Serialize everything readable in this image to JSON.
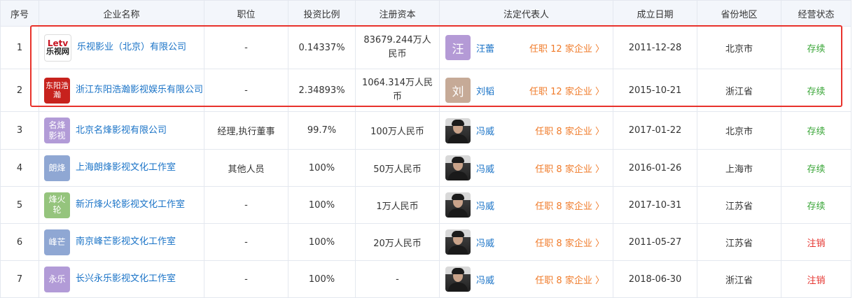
{
  "headers": [
    "序号",
    "企业名称",
    "职位",
    "投资比例",
    "注册资本",
    "法定代表人",
    "成立日期",
    "省份地区",
    "经营状态"
  ],
  "rows": [
    {
      "no": "1",
      "logo_text": "Letv乐视网",
      "company": "乐视影业（北京）有限公司",
      "position": "-",
      "ratio": "0.14337%",
      "capital": "83679.244万人民币",
      "rep_avatar": "汪",
      "rep": "汪蕾",
      "rep_link": "任职 12 家企业",
      "date": "2011-12-28",
      "region": "北京市",
      "status": "存续"
    },
    {
      "no": "2",
      "logo_text": "东阳浩瀚",
      "company": "浙江东阳浩瀚影视娱乐有限公司",
      "position": "-",
      "ratio": "2.34893%",
      "capital": "1064.314万人民币",
      "rep_avatar": "刘",
      "rep": "刘韬",
      "rep_link": "任职 12 家企业",
      "date": "2015-10-21",
      "region": "浙江省",
      "status": "存续"
    },
    {
      "no": "3",
      "logo_text": "名烽影视",
      "company": "北京名烽影视有限公司",
      "position": "经理,执行董事",
      "ratio": "99.7%",
      "capital": "100万人民币",
      "rep_avatar": "",
      "rep": "冯威",
      "rep_link": "任职 8 家企业",
      "date": "2017-01-22",
      "region": "北京市",
      "status": "存续"
    },
    {
      "no": "4",
      "logo_text": "朗烽",
      "company": "上海朗烽影视文化工作室",
      "position": "其他人员",
      "ratio": "100%",
      "capital": "50万人民币",
      "rep_avatar": "",
      "rep": "冯威",
      "rep_link": "任职 8 家企业",
      "date": "2016-01-26",
      "region": "上海市",
      "status": "存续"
    },
    {
      "no": "5",
      "logo_text": "烽火轮",
      "company": "新沂烽火轮影视文化工作室",
      "position": "-",
      "ratio": "100%",
      "capital": "1万人民币",
      "rep_avatar": "",
      "rep": "冯威",
      "rep_link": "任职 8 家企业",
      "date": "2017-10-31",
      "region": "江苏省",
      "status": "存续"
    },
    {
      "no": "6",
      "logo_text": "峰芒",
      "company": "南京峰芒影视文化工作室",
      "position": "-",
      "ratio": "100%",
      "capital": "20万人民币",
      "rep_avatar": "",
      "rep": "冯威",
      "rep_link": "任职 8 家企业",
      "date": "2011-05-27",
      "region": "江苏省",
      "status": "注销"
    },
    {
      "no": "7",
      "logo_text": "永乐",
      "company": "长兴永乐影视文化工作室",
      "position": "-",
      "ratio": "100%",
      "capital": "-",
      "rep_avatar": "",
      "rep": "冯威",
      "rep_link": "任职 8 家企业",
      "date": "2018-06-30",
      "region": "浙江省",
      "status": "注销"
    }
  ],
  "colors": {
    "link": "#1a73c7",
    "orange": "#f07b2a",
    "active": "#3aa638",
    "cancelled": "#e5332e",
    "highlight": "#e8322c"
  }
}
